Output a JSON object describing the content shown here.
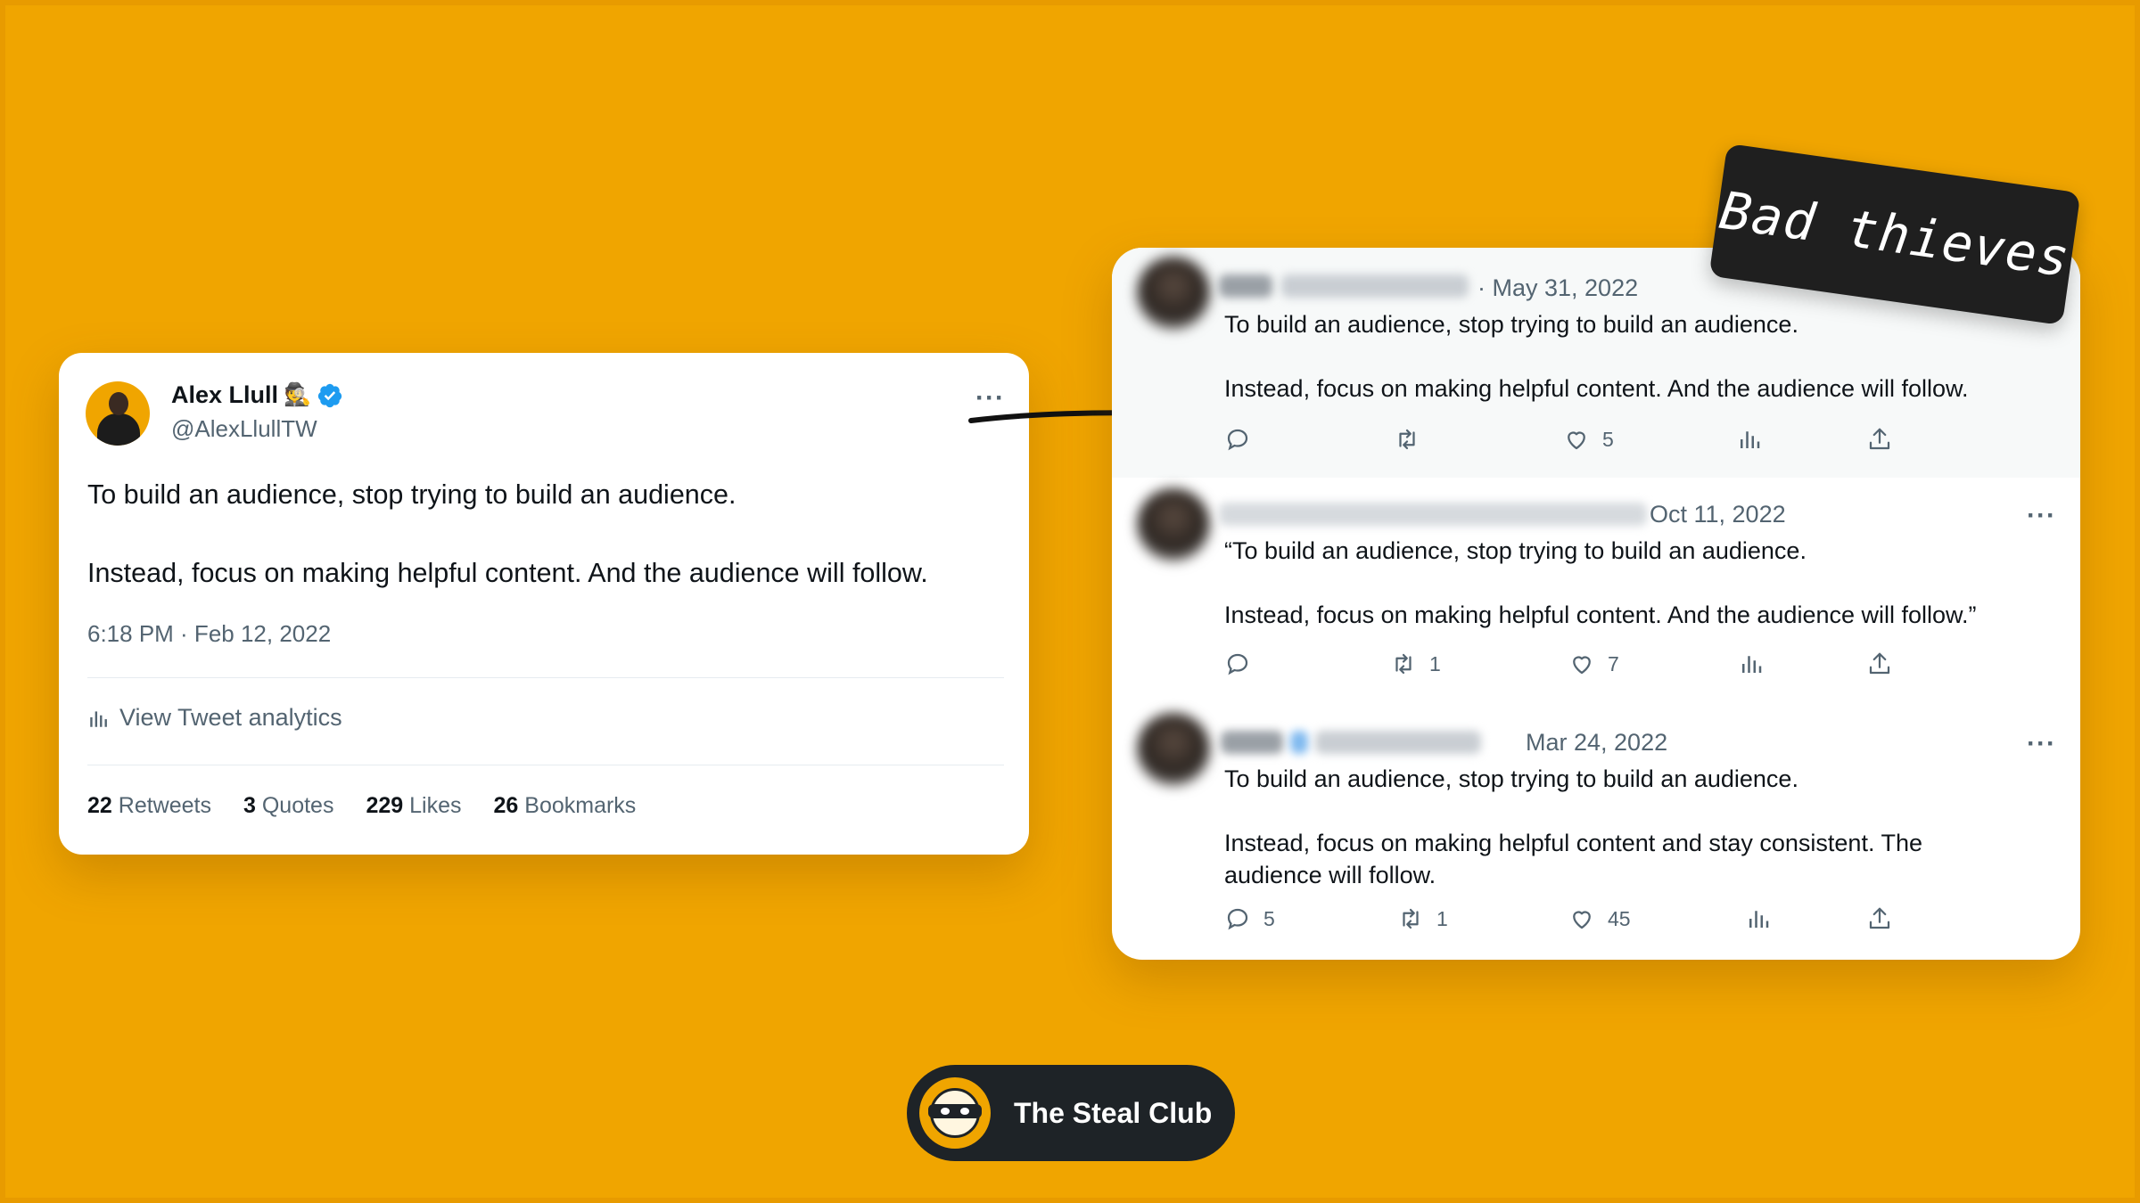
{
  "original_tweet": {
    "name": "Alex Llull",
    "name_emoji": "🕵",
    "handle": "@AlexLlullTW",
    "more": "···",
    "line1": "To build an audience, stop trying to build an audience.",
    "line2": "Instead, focus on making helpful content. And the audience will follow.",
    "timestamp": "6:18 PM · Feb 12, 2022",
    "analytics_label": "View Tweet analytics",
    "stats": [
      {
        "num": "22",
        "label": "Retweets"
      },
      {
        "num": "3",
        "label": "Quotes"
      },
      {
        "num": "229",
        "label": "Likes"
      },
      {
        "num": "26",
        "label": "Bookmarks"
      }
    ]
  },
  "copies": [
    {
      "date": "· May 31, 2022",
      "line1": "To build an audience, stop trying to build an audience.",
      "line2": "Instead, focus on making helpful content. And the audience will follow.",
      "line3": "",
      "replies": "",
      "retweets": "",
      "likes": "5"
    },
    {
      "date": "Oct 11, 2022",
      "more": "···",
      "line1": "“To build an audience, stop trying to build an audience.",
      "line2": "Instead, focus on making helpful content. And the audience will follow.”",
      "line3": "",
      "replies": "",
      "retweets": "1",
      "likes": "7"
    },
    {
      "date": "Mar 24, 2022",
      "more": "···",
      "line1": "To build an audience, stop trying to build an audience.",
      "line2": "Instead, focus on making helpful content and stay consistent. The",
      "line3": "audience will follow.",
      "replies": "5",
      "retweets": "1",
      "likes": "45"
    }
  ],
  "sticker_text": "Bad thieves",
  "brand": "The Steal Club",
  "colors": {
    "background": "#f0a500",
    "verified": "#1d9bf0",
    "muted": "#536471",
    "sticker": "#1f1f1f",
    "pill": "#1e2327"
  },
  "icons": [
    "verified-icon",
    "more-icon",
    "analytics-icon",
    "reply-icon",
    "retweet-icon",
    "like-icon",
    "views-icon",
    "share-icon",
    "arrow-icon",
    "mask-logo-icon"
  ]
}
